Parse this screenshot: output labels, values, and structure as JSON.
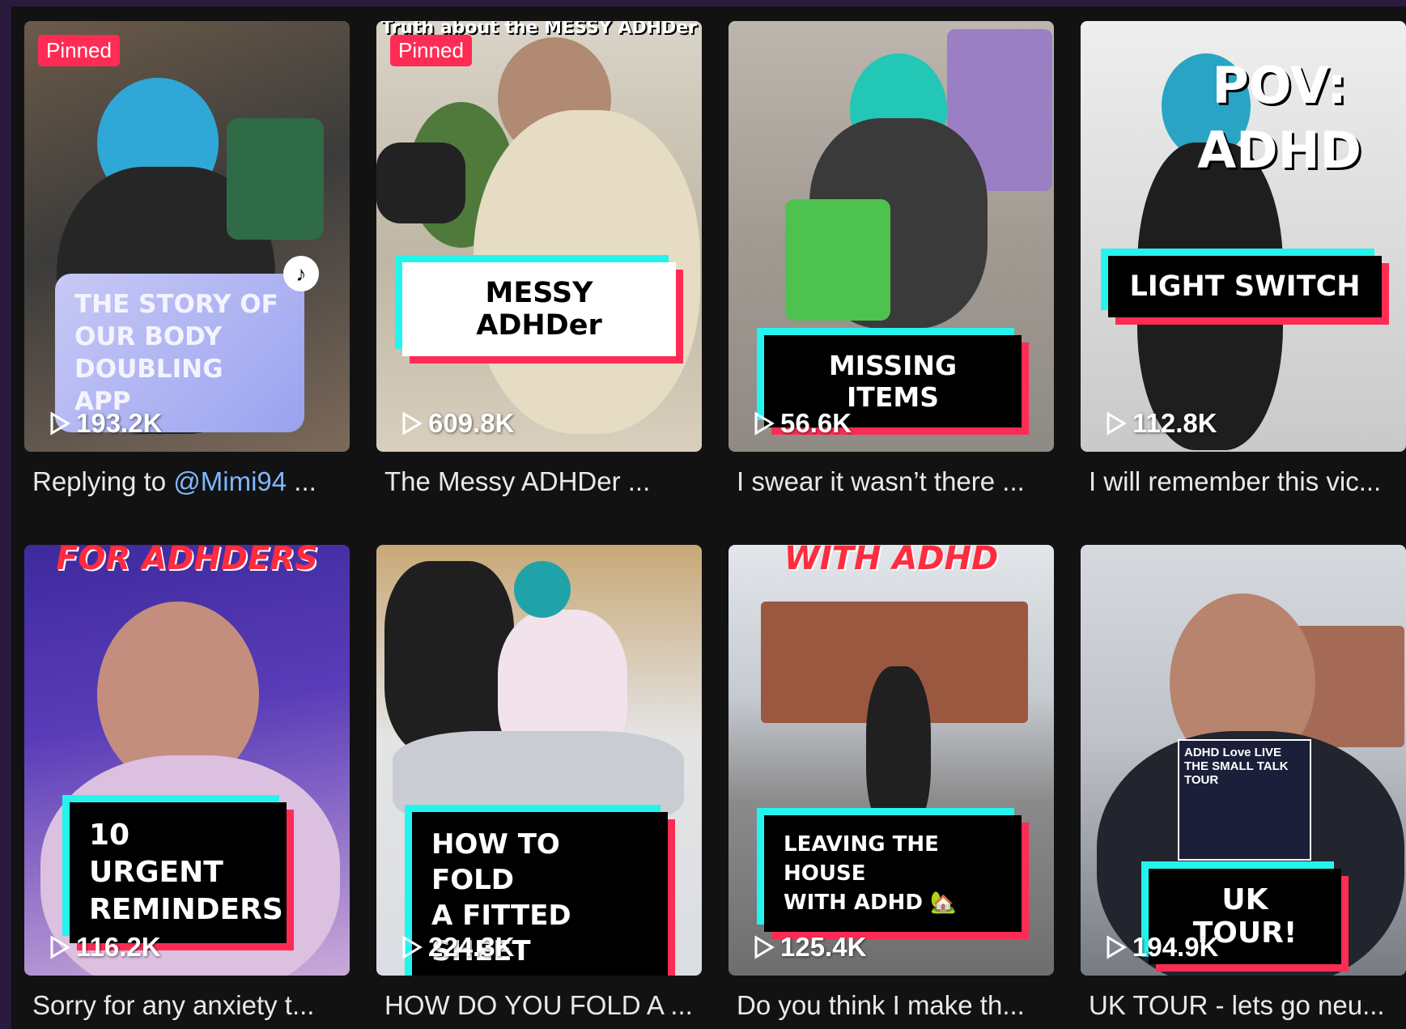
{
  "videos": [
    {
      "pinned": "Pinned",
      "caption": "THE STORY OF OUR BODY DOUBLING APP",
      "views": "193.2K",
      "desc_prefix": "Replying to ",
      "desc_mention": "@Mimi94",
      "desc_suffix": " ...",
      "colors": [
        "#5a4a3c",
        "#2e6a52",
        "#8c7a66"
      ]
    },
    {
      "pinned": "Pinned",
      "toptext": "Truth about the MESSY ADHDer",
      "caption": "MESSY ADHDer",
      "views": "609.8K",
      "desc": "The Messy ADHDer ...",
      "colors": [
        "#c9c2b4",
        "#5a6b3a",
        "#e8e1cf"
      ]
    },
    {
      "caption": "MISSING ITEMS",
      "views": "56.6K",
      "desc": "I swear it wasn’t there ...",
      "colors": [
        "#9f9a94",
        "#6f8a5e",
        "#c7c0b7"
      ]
    },
    {
      "pov_line1": "POV:",
      "pov_line2": "ADHD",
      "caption": "LIGHT SWITCH",
      "views": "112.8K",
      "desc": "I will remember this vic...",
      "colors": [
        "#e7e7e7",
        "#2b2b2b",
        "#cfcfcf"
      ]
    },
    {
      "toptext": "FOR ADHDERS",
      "caption_line1": "10 URGENT",
      "caption_line2": "REMINDERS",
      "views": "116.2K",
      "desc": "Sorry for any anxiety t...",
      "colors": [
        "#4b2fa8",
        "#c98c83",
        "#d6b9e6"
      ]
    },
    {
      "caption_line1": "HOW TO FOLD",
      "caption_line2": "A FITTED SHEET",
      "views": "224.3K",
      "desc": "HOW DO YOU FOLD A ...",
      "colors": [
        "#b99e72",
        "#dcdcdc",
        "#e8e8ec"
      ]
    },
    {
      "toptext": "WITH ADHD",
      "caption_line1": "LEAVING THE HOUSE",
      "caption_line2": "WITH ADHD 🏡",
      "views": "125.4K",
      "desc": "Do you think I make th...",
      "colors": [
        "#d7dbe0",
        "#9b5a44",
        "#7a7a7a"
      ]
    },
    {
      "mini_line1": "ADHD Love LIVE",
      "mini_line2": "THE SMALL TALK TOUR",
      "caption": "UK TOUR!",
      "views": "194.9K",
      "desc": "UK TOUR - lets go neu...",
      "colors": [
        "#c9ced6",
        "#2a2d36",
        "#a47763"
      ]
    }
  ]
}
